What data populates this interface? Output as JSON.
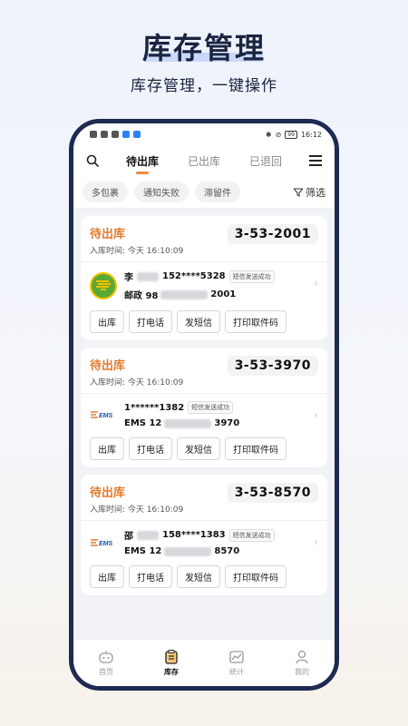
{
  "hero": {
    "title": "库存管理",
    "subtitle": "库存管理，一键操作"
  },
  "statusbar": {
    "time": "16:12",
    "battery": "99"
  },
  "topbar": {
    "tabs": [
      {
        "label": "待出库",
        "active": true
      },
      {
        "label": "已出库",
        "active": false
      },
      {
        "label": "已退回",
        "active": false
      }
    ]
  },
  "filters": {
    "chips": [
      "多包裹",
      "通知失败",
      "滞留件"
    ],
    "filter_label": "筛选"
  },
  "cards": [
    {
      "status": "待出库",
      "in_time": "入库时间: 今天 16:10:09",
      "code": "3-53-2001",
      "carrier_icon": "china-post-logo",
      "recipient_prefix": "李",
      "phone": "152****5328",
      "sms_status": "短信发送成功",
      "tracking_prefix": "邮政 98",
      "tracking_suffix": "2001"
    },
    {
      "status": "待出库",
      "in_time": "入库时间: 今天 16:10:09",
      "code": "3-53-3970",
      "carrier_icon": "ems-logo",
      "recipient_prefix": "",
      "phone": "1******1382",
      "sms_status": "短信发送成功",
      "tracking_prefix": "EMS 12",
      "tracking_suffix": "3970"
    },
    {
      "status": "待出库",
      "in_time": "入库时间: 今天 16:10:09",
      "code": "3-53-8570",
      "carrier_icon": "ems-logo",
      "recipient_prefix": "邵",
      "phone": "158****1383",
      "sms_status": "短信发送成功",
      "tracking_prefix": "EMS 12",
      "tracking_suffix": "8570"
    }
  ],
  "actions": [
    "出库",
    "打电话",
    "发短信",
    "打印取件码"
  ],
  "bottomnav": [
    {
      "label": "首页",
      "icon": "home-robot-icon",
      "active": false
    },
    {
      "label": "库存",
      "icon": "inventory-icon",
      "active": true
    },
    {
      "label": "统计",
      "icon": "stats-icon",
      "active": false
    },
    {
      "label": "我的",
      "icon": "profile-icon",
      "active": false
    }
  ],
  "colors": {
    "accent": "#e27a2c",
    "frame": "#1e2a52",
    "post_green": "#5aa936"
  }
}
